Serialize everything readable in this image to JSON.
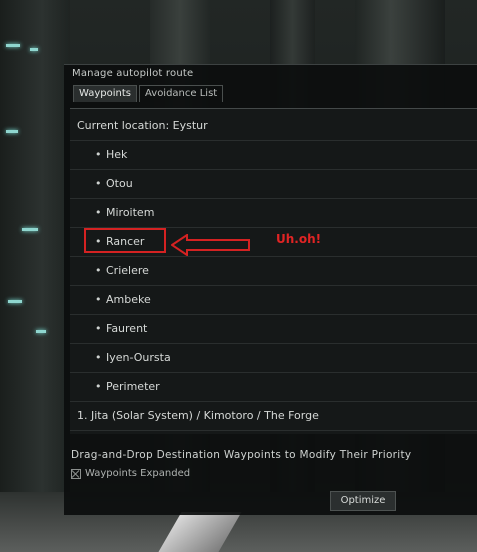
{
  "window": {
    "title": "Manage autopilot route"
  },
  "tabs": [
    {
      "label": "Waypoints",
      "active": true
    },
    {
      "label": "Avoidance List",
      "active": false
    }
  ],
  "route": {
    "current_location": "Current location: Eystur",
    "bullet": "•",
    "waypoints": [
      "Hek",
      "Otou",
      "Miroitem",
      "Rancer",
      "Crielere",
      "Ambeke",
      "Faurent",
      "Iyen-Oursta",
      "Perimeter"
    ],
    "destination": "1. Jita (Solar System) / Kimotoro / The Forge"
  },
  "footer": {
    "hint": "Drag-and-Drop Destination Waypoints to Modify Their Priority",
    "checkbox_label": "Waypoints Expanded",
    "optimize_label": "Optimize"
  },
  "annotation": {
    "text": "Uh.oh!",
    "highlight_color": "#d42222"
  }
}
